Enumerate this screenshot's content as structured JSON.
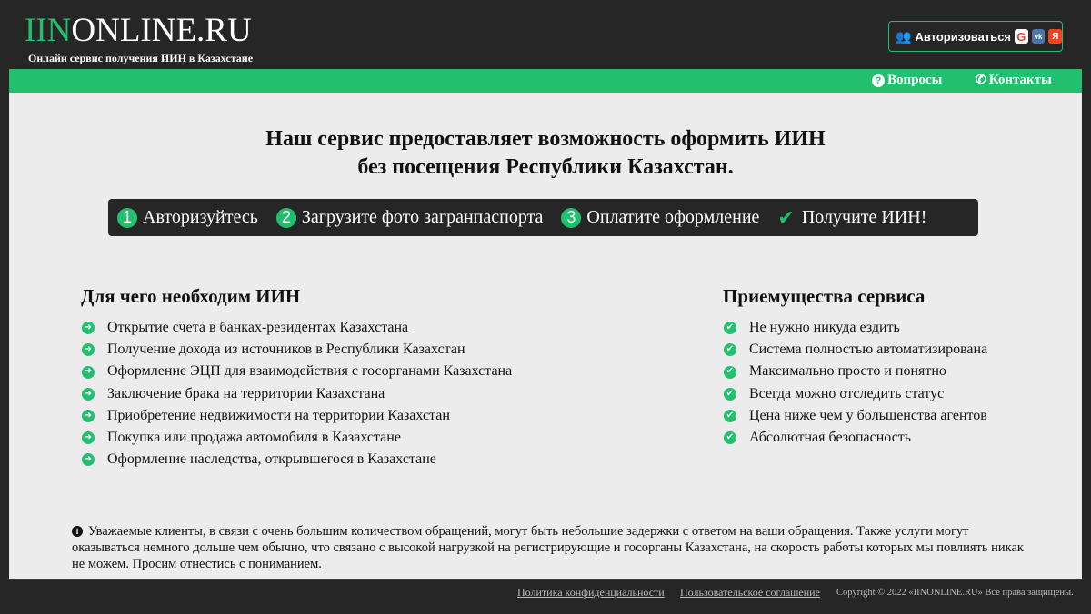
{
  "header": {
    "logo_accent": "IIN",
    "logo_rest": "ONLINE.RU",
    "tagline": "Онлайн сервис получения ИИН в Казахстане",
    "auth_label": "Авторизоваться",
    "social": [
      "G",
      "vk",
      "Я"
    ]
  },
  "nav": {
    "questions": "Вопросы",
    "contacts": "Контакты"
  },
  "main": {
    "headline_line1": "Наш сервис предоставляет возможность оформить ИИН",
    "headline_line2": "без посещения Республики Казахстан.",
    "steps": [
      {
        "num": "1",
        "label": "Авторизуйтесь"
      },
      {
        "num": "2",
        "label": "Загрузите фото загранпаспорта"
      },
      {
        "num": "3",
        "label": "Оплатите оформление"
      },
      {
        "num": "✔",
        "label": "Получите ИИН!"
      }
    ],
    "why_title": "Для чего необходим ИИН",
    "why_items": [
      "Открытие счета в банках-резидентах Казахстана",
      "Получение дохода из источников в Республики Казахстан",
      "Оформление ЭЦП для взаимодействия с госорганами Казахстана",
      "Заключение брака на территории Казахстана",
      "Приобретение недвижимости на территории Казахстан",
      "Покупка или продажа автомобиля в Казахстане",
      "Оформление наследства, открывшегося в Казахстане"
    ],
    "adv_title": "Приемущества сервиса",
    "adv_items": [
      "Не нужно никуда ездить",
      "Система полностью автоматизирована",
      "Максимально просто и понятно",
      "Всегда можно отследить статус",
      "Цена ниже чем у большенства агентов",
      "Абсолютная безопасность"
    ],
    "notice": "Уважаемые клиенты, в связи с очень большим количеством обращений, могут быть небольшие задержки с ответом на ваши обращения. Также услуги могут оказываться немного дольше чем обычно, что связано с высокой нагрузкой на регистрирующие и госорганы Казахстана, на скорость работы которых мы повлиять никак не можем. Просим отнестись с пониманием."
  },
  "footer": {
    "privacy": "Политика конфиденциальности",
    "agreement": "Пользовательское соглашение",
    "copyright": "Copyright © 2022 «IINONLINE.RU» Все права защищены."
  },
  "colors": {
    "accent": "#22c06e",
    "dark": "#262626",
    "content_bg": "#ececec"
  }
}
